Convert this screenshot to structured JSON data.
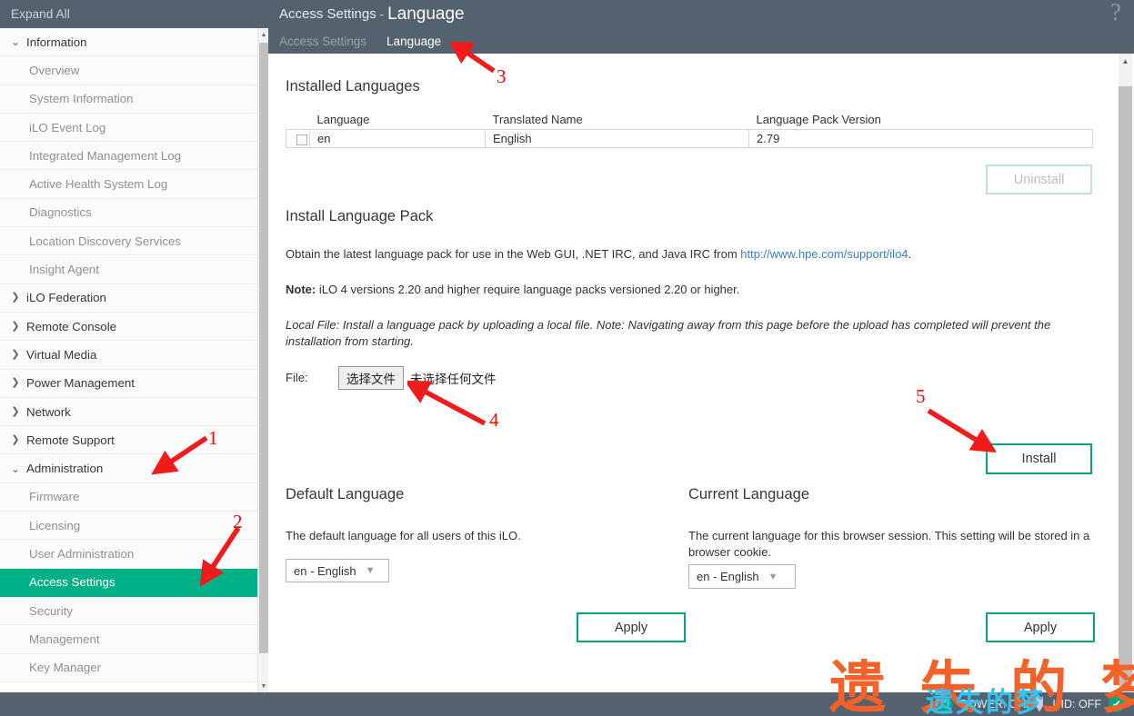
{
  "sidebar": {
    "expand_all_label": "Expand All",
    "items": [
      {
        "label": "Information",
        "type": "group",
        "state": "expanded"
      },
      {
        "label": "Overview",
        "type": "leaf"
      },
      {
        "label": "System Information",
        "type": "leaf"
      },
      {
        "label": "iLO Event Log",
        "type": "leaf"
      },
      {
        "label": "Integrated Management Log",
        "type": "leaf"
      },
      {
        "label": "Active Health System Log",
        "type": "leaf"
      },
      {
        "label": "Diagnostics",
        "type": "leaf"
      },
      {
        "label": "Location Discovery Services",
        "type": "leaf"
      },
      {
        "label": "Insight Agent",
        "type": "leaf"
      },
      {
        "label": "iLO Federation",
        "type": "group",
        "state": "collapsed"
      },
      {
        "label": "Remote Console",
        "type": "group",
        "state": "collapsed"
      },
      {
        "label": "Virtual Media",
        "type": "group",
        "state": "collapsed"
      },
      {
        "label": "Power Management",
        "type": "group",
        "state": "collapsed"
      },
      {
        "label": "Network",
        "type": "group",
        "state": "collapsed"
      },
      {
        "label": "Remote Support",
        "type": "group",
        "state": "collapsed"
      },
      {
        "label": "Administration",
        "type": "group",
        "state": "expanded"
      },
      {
        "label": "Firmware",
        "type": "leaf"
      },
      {
        "label": "Licensing",
        "type": "leaf"
      },
      {
        "label": "User Administration",
        "type": "leaf"
      },
      {
        "label": "Access Settings",
        "type": "leaf",
        "selected": true
      },
      {
        "label": "Security",
        "type": "leaf"
      },
      {
        "label": "Management",
        "type": "leaf"
      },
      {
        "label": "Key Manager",
        "type": "leaf"
      }
    ]
  },
  "header": {
    "breadcrumb_parent": "Access Settings",
    "breadcrumb_separator": "-",
    "breadcrumb_current": "Language",
    "help_icon": "question-mark-icon"
  },
  "tabs": [
    {
      "label": "Access Settings",
      "active": false
    },
    {
      "label": "Language",
      "active": true
    }
  ],
  "installed_languages": {
    "title": "Installed Languages",
    "columns": [
      "",
      "Language",
      "Translated Name",
      "Language Pack Version"
    ],
    "rows": [
      {
        "checked": false,
        "language": "en",
        "translated_name": "English",
        "version": "2.79"
      }
    ],
    "uninstall_label": "Uninstall",
    "uninstall_disabled": true
  },
  "install_pack": {
    "title": "Install Language Pack",
    "obtain_text_pre": "Obtain the latest language pack for use in the Web GUI, .NET IRC, and Java IRC from ",
    "obtain_link": "http://www.hpe.com/support/ilo4",
    "obtain_text_post": ".",
    "note_label": "Note:",
    "note_text": " iLO 4 versions 2.20 and higher require language packs versioned 2.20 or higher.",
    "local_file_label": "Local File:",
    "local_file_text": " Install a language pack by uploading a local file.  Note: Navigating away from this page before the upload has completed will prevent the installation from starting.",
    "file_label": "File:",
    "file_button_label": "选择文件",
    "file_status": "未选择任何文件",
    "install_label": "Install"
  },
  "default_language": {
    "title": "Default Language",
    "description": "The default language for all users of this iLO.",
    "selected": "en - English",
    "apply_label": "Apply"
  },
  "current_language": {
    "title": "Current Language",
    "description": "The current language for this browser session. This setting will be stored in a browser cookie.",
    "selected": "en - English",
    "apply_label": "Apply"
  },
  "footer": {
    "power_label": "POWER: ON",
    "uid_label": "UID: OFF",
    "power_icon": "power-icon",
    "uid_icon": "uid-led-icon",
    "health_icon": "check-circle-icon"
  },
  "annotations": [
    {
      "id": "1",
      "label": "1"
    },
    {
      "id": "2",
      "label": "2"
    },
    {
      "id": "3",
      "label": "3"
    },
    {
      "id": "4",
      "label": "4"
    },
    {
      "id": "5",
      "label": "5"
    }
  ],
  "watermarks": {
    "big": "遗 失 的 梦",
    "small": "遗失的梦"
  },
  "colors": {
    "header_bg": "#54616e",
    "accent_green": "#00b188",
    "button_green": "#00a481",
    "link_blue": "#3a7fc1",
    "annotation_red": "#ff0000"
  }
}
